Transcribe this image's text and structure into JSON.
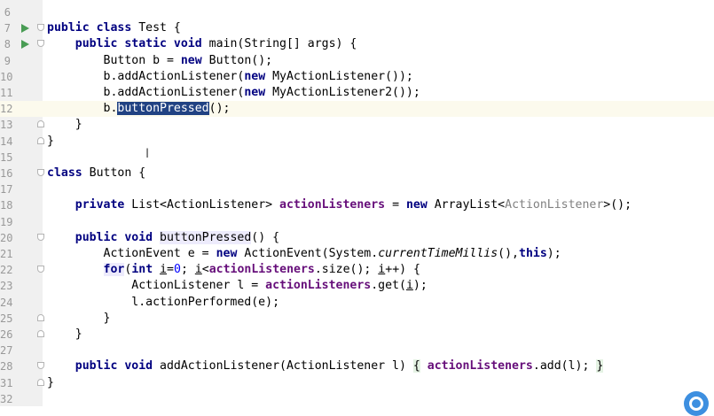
{
  "editor": {
    "lines": [
      {
        "number": "6",
        "has_run": false,
        "fold": "none",
        "caret": false,
        "segments": []
      },
      {
        "number": "7",
        "has_run": true,
        "fold": "open",
        "caret": false,
        "segments": [
          {
            "text": "public class ",
            "cls": "kw"
          },
          {
            "text": "Test {",
            "cls": ""
          }
        ]
      },
      {
        "number": "8",
        "has_run": true,
        "fold": "open",
        "caret": false,
        "segments": [
          {
            "text": "    ",
            "cls": ""
          },
          {
            "text": "public static void ",
            "cls": "kw"
          },
          {
            "text": "main(String[] args) {",
            "cls": ""
          }
        ]
      },
      {
        "number": "9",
        "has_run": false,
        "fold": "none",
        "caret": false,
        "segments": [
          {
            "text": "        Button b = ",
            "cls": ""
          },
          {
            "text": "new ",
            "cls": "kw"
          },
          {
            "text": "Button();",
            "cls": ""
          }
        ]
      },
      {
        "number": "10",
        "has_run": false,
        "fold": "none",
        "caret": false,
        "segments": [
          {
            "text": "        b.addActionListener(",
            "cls": ""
          },
          {
            "text": "new ",
            "cls": "kw"
          },
          {
            "text": "MyActionListener());",
            "cls": ""
          }
        ]
      },
      {
        "number": "11",
        "has_run": false,
        "fold": "none",
        "caret": false,
        "segments": [
          {
            "text": "        b.addActionListener(",
            "cls": ""
          },
          {
            "text": "new ",
            "cls": "kw"
          },
          {
            "text": "MyActionListener2());",
            "cls": ""
          }
        ]
      },
      {
        "number": "12",
        "has_run": false,
        "fold": "none",
        "caret": true,
        "segments": [
          {
            "text": "        b.",
            "cls": ""
          },
          {
            "text": "buttonPressed",
            "cls": "sel"
          },
          {
            "text": "();",
            "cls": ""
          }
        ]
      },
      {
        "number": "13",
        "has_run": false,
        "fold": "close",
        "caret": false,
        "segments": [
          {
            "text": "    }",
            "cls": ""
          }
        ]
      },
      {
        "number": "14",
        "has_run": false,
        "fold": "close",
        "caret": false,
        "segments": [
          {
            "text": "}",
            "cls": ""
          }
        ]
      },
      {
        "number": "15",
        "has_run": false,
        "fold": "none",
        "caret": false,
        "segments": []
      },
      {
        "number": "16",
        "has_run": false,
        "fold": "open",
        "caret": false,
        "segments": [
          {
            "text": "class ",
            "cls": "kw"
          },
          {
            "text": "Button {",
            "cls": ""
          }
        ]
      },
      {
        "number": "17",
        "has_run": false,
        "fold": "none",
        "caret": false,
        "segments": []
      },
      {
        "number": "18",
        "has_run": false,
        "fold": "none",
        "caret": false,
        "segments": [
          {
            "text": "    ",
            "cls": ""
          },
          {
            "text": "private ",
            "cls": "kw"
          },
          {
            "text": "List<ActionListener> ",
            "cls": ""
          },
          {
            "text": "actionListeners",
            "cls": "fld"
          },
          {
            "text": " = ",
            "cls": ""
          },
          {
            "text": "new ",
            "cls": "kw"
          },
          {
            "text": "ArrayList<",
            "cls": ""
          },
          {
            "text": "ActionListener",
            "cls": "gray"
          },
          {
            "text": ">();",
            "cls": ""
          }
        ]
      },
      {
        "number": "19",
        "has_run": false,
        "fold": "none",
        "caret": false,
        "segments": []
      },
      {
        "number": "20",
        "has_run": false,
        "fold": "open",
        "caret": false,
        "segments": [
          {
            "text": "    ",
            "cls": ""
          },
          {
            "text": "public void ",
            "cls": "kw"
          },
          {
            "text": "buttonPressed",
            "cls": "ident"
          },
          {
            "text": "() {",
            "cls": ""
          }
        ]
      },
      {
        "number": "21",
        "has_run": false,
        "fold": "none",
        "caret": false,
        "segments": [
          {
            "text": "        ActionEvent e = ",
            "cls": ""
          },
          {
            "text": "new ",
            "cls": "kw"
          },
          {
            "text": "ActionEvent(System.",
            "cls": ""
          },
          {
            "text": "currentTimeMillis",
            "cls": "it"
          },
          {
            "text": "(),",
            "cls": ""
          },
          {
            "text": "this",
            "cls": "kw"
          },
          {
            "text": ");",
            "cls": ""
          }
        ]
      },
      {
        "number": "22",
        "has_run": false,
        "fold": "open",
        "caret": false,
        "segments": [
          {
            "text": "        ",
            "cls": ""
          },
          {
            "text": "for",
            "cls": "kw ident"
          },
          {
            "text": "(",
            "cls": ""
          },
          {
            "text": "int ",
            "cls": "kw"
          },
          {
            "text": "i",
            "cls": "ul"
          },
          {
            "text": "=",
            "cls": ""
          },
          {
            "text": "0",
            "cls": "num"
          },
          {
            "text": "; ",
            "cls": ""
          },
          {
            "text": "i",
            "cls": "ul"
          },
          {
            "text": "<",
            "cls": ""
          },
          {
            "text": "actionListeners",
            "cls": "fld"
          },
          {
            "text": ".size(); ",
            "cls": ""
          },
          {
            "text": "i",
            "cls": "ul"
          },
          {
            "text": "++) {",
            "cls": ""
          }
        ]
      },
      {
        "number": "23",
        "has_run": false,
        "fold": "none",
        "caret": false,
        "segments": [
          {
            "text": "            ActionListener l = ",
            "cls": ""
          },
          {
            "text": "actionListeners",
            "cls": "fld"
          },
          {
            "text": ".get(",
            "cls": ""
          },
          {
            "text": "i",
            "cls": "ul"
          },
          {
            "text": ");",
            "cls": ""
          }
        ]
      },
      {
        "number": "24",
        "has_run": false,
        "fold": "none",
        "caret": false,
        "segments": [
          {
            "text": "            l.actionPerformed(e);",
            "cls": ""
          }
        ]
      },
      {
        "number": "25",
        "has_run": false,
        "fold": "close",
        "caret": false,
        "segments": [
          {
            "text": "        }",
            "cls": ""
          }
        ]
      },
      {
        "number": "26",
        "has_run": false,
        "fold": "close",
        "caret": false,
        "segments": [
          {
            "text": "    }",
            "cls": ""
          }
        ]
      },
      {
        "number": "27",
        "has_run": false,
        "fold": "none",
        "caret": false,
        "segments": []
      },
      {
        "number": "28",
        "has_run": false,
        "fold": "open",
        "caret": false,
        "segments": [
          {
            "text": "    ",
            "cls": ""
          },
          {
            "text": "public void ",
            "cls": "kw"
          },
          {
            "text": "addActionListener(ActionListener l) ",
            "cls": ""
          },
          {
            "text": "{",
            "cls": "fh"
          },
          {
            "text": " ",
            "cls": ""
          },
          {
            "text": "actionListeners",
            "cls": "fld"
          },
          {
            "text": ".add(l); ",
            "cls": ""
          },
          {
            "text": "}",
            "cls": "fh"
          }
        ]
      },
      {
        "number": "31",
        "has_run": false,
        "fold": "close",
        "caret": false,
        "segments": [
          {
            "text": "}",
            "cls": ""
          }
        ]
      },
      {
        "number": "32",
        "has_run": false,
        "fold": "none",
        "caret": false,
        "segments": []
      }
    ]
  },
  "colors": {
    "keyword": "#000080",
    "field": "#660e7a",
    "number": "#0000ff",
    "selection": "#214283",
    "caret_line": "#fcfaed",
    "run_gutter": "#499c54"
  }
}
